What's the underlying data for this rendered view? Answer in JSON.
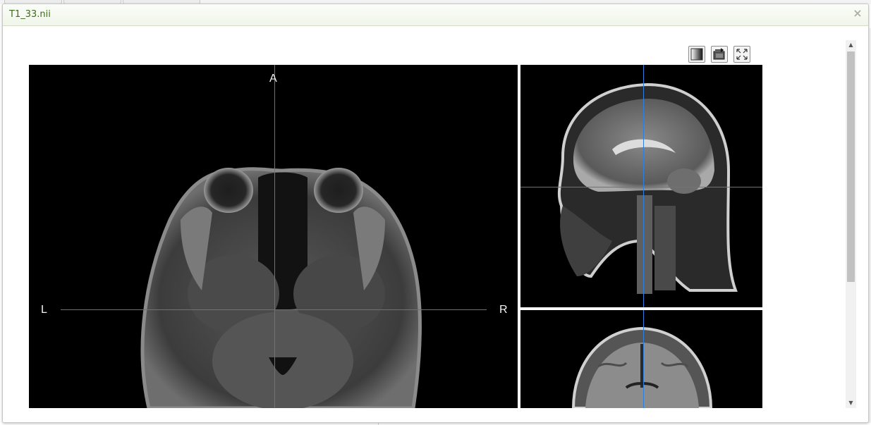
{
  "dialog": {
    "title": "T1_33.nii",
    "close_glyph": "×"
  },
  "toolbar": {
    "buttons": [
      {
        "name": "contrast-icon"
      },
      {
        "name": "swap-views-icon"
      },
      {
        "name": "fullscreen-icon"
      }
    ]
  },
  "viewer": {
    "axial": {
      "label_anterior": "A",
      "label_left": "L",
      "label_right": "R"
    },
    "crosshair_color": "#2e7fe0"
  },
  "scrollbar": {
    "up_glyph": "▲",
    "down_glyph": "▼"
  }
}
